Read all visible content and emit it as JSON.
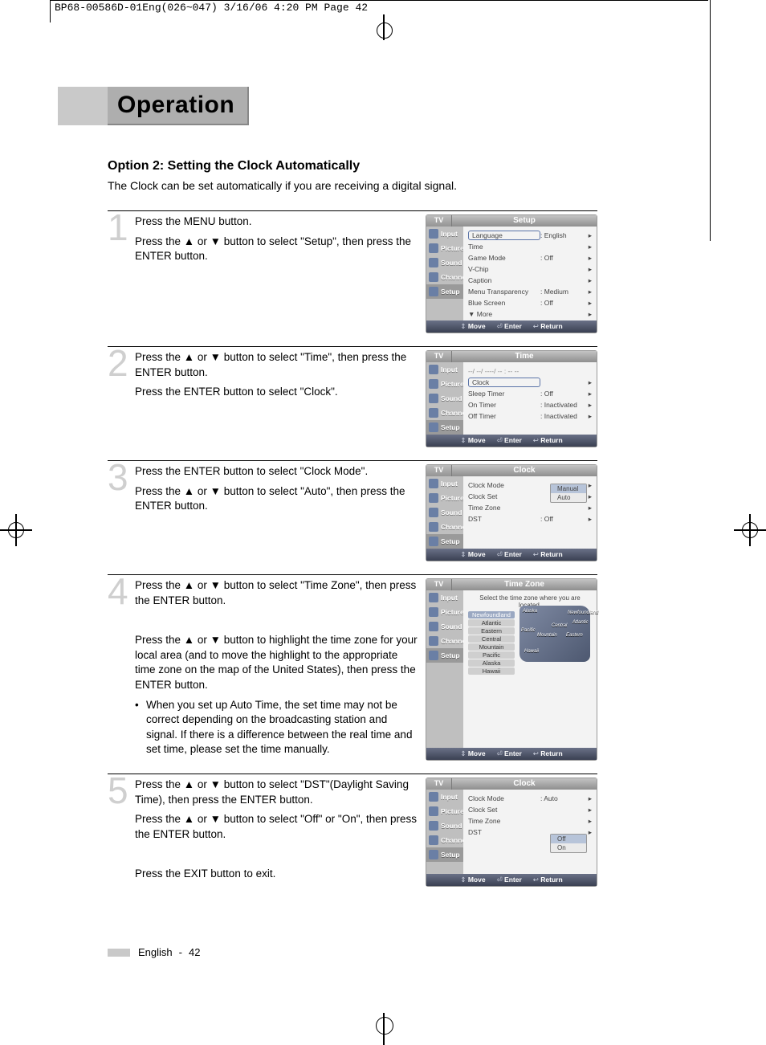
{
  "slug": "BP68-00586D-01Eng(026~047)  3/16/06  4:20 PM  Page 42",
  "page_footer": {
    "lang": "English",
    "page": "42"
  },
  "section_title": "Operation",
  "option": {
    "heading": "Option 2: Setting the Clock Automatically",
    "desc": "The Clock can be set automatically if you are receiving a digital signal."
  },
  "arrows": {
    "up": "▲",
    "down": "▼"
  },
  "sidebar_labels": {
    "tv": "TV",
    "input": "Input",
    "picture": "Picture",
    "sound": "Sound",
    "channel": "Channel",
    "setup": "Setup"
  },
  "footer_hints": {
    "move": "Move",
    "enter": "Enter",
    "return": "Return"
  },
  "steps": [
    {
      "num": "1",
      "text": "Press the MENU button.\nPress the ▲ or ▼ button to select \"Setup\", then press the ENTER button.",
      "osd": {
        "title": "Setup",
        "rows": [
          {
            "k": "Language",
            "v": ": English",
            "boxed": true
          },
          {
            "k": "Time",
            "v": ""
          },
          {
            "k": "Game Mode",
            "v": ": Off"
          },
          {
            "k": "V-Chip",
            "v": ""
          },
          {
            "k": "Caption",
            "v": ""
          },
          {
            "k": "Menu Transparency",
            "v": ": Medium"
          },
          {
            "k": "Blue Screen",
            "v": ": Off"
          },
          {
            "k": "▼ More",
            "v": ""
          }
        ]
      }
    },
    {
      "num": "2",
      "text": "Press the ▲ or ▼ button to select \"Time\", then press the ENTER button.\nPress the ENTER button to select \"Clock\".",
      "osd": {
        "title": "Time",
        "header_line": "--/ --/ ----/ -- : -- --",
        "rows": [
          {
            "k": "Clock",
            "v": "",
            "boxed": true
          },
          {
            "k": "Sleep Timer",
            "v": ": Off"
          },
          {
            "k": "On Timer",
            "v": ": Inactivated"
          },
          {
            "k": "Off Timer",
            "v": ": Inactivated"
          }
        ]
      }
    },
    {
      "num": "3",
      "text": "Press the ENTER button to select \"Clock Mode\".\nPress the ▲ or ▼ button to select \"Auto\", then press the ENTER button.",
      "osd": {
        "title": "Clock",
        "rows": [
          {
            "k": "Clock Mode",
            "v": ""
          },
          {
            "k": "Clock Set",
            "v": ""
          },
          {
            "k": "Time Zone",
            "v": ""
          },
          {
            "k": "DST",
            "v": ": Off"
          }
        ],
        "dropdown": {
          "options": [
            "Manual",
            "Auto"
          ],
          "selected": "Manual"
        }
      }
    },
    {
      "num": "4",
      "text": "Press the ▲ or ▼ button to select \"Time Zone\", then press the ENTER button.\n\nPress the ▲ or ▼ button to highlight the time zone for your local area (and to move the highlight to the appropriate time zone on the map of the United States), then press the ENTER button.",
      "bullet": "When you set up Auto Time, the set time may not be correct depending on the broadcasting station and signal. If there is a difference between the real time and set time, please set the time manually.",
      "osd": {
        "title": "Time Zone",
        "hint": "Select the time zone where you are located.",
        "zones": [
          "Newfoundland",
          "Atlantic",
          "Eastern",
          "Central",
          "Mountain",
          "Pacific",
          "Alaska",
          "Hawaii"
        ],
        "zone_selected": "Newfoundland",
        "map_labels": [
          "Alaska",
          "Pacific",
          "Mountain",
          "Central",
          "Eastern",
          "Atlantic",
          "Newfoundland",
          "Hawaii"
        ]
      }
    },
    {
      "num": "5",
      "text": "Press the ▲ or ▼ button to select \"DST\"(Daylight Saving Time), then press the ENTER button.\nPress the ▲ or ▼ button to select \"Off\" or \"On\", then press the ENTER button.\n\nPress the EXIT button to exit.",
      "osd": {
        "title": "Clock",
        "rows": [
          {
            "k": "Clock Mode",
            "v": ": Auto"
          },
          {
            "k": "Clock Set",
            "v": ""
          },
          {
            "k": "Time Zone",
            "v": ""
          },
          {
            "k": "DST",
            "v": ""
          }
        ],
        "dropdown": {
          "options": [
            "Off",
            "On"
          ],
          "selected": "Off"
        }
      }
    }
  ]
}
